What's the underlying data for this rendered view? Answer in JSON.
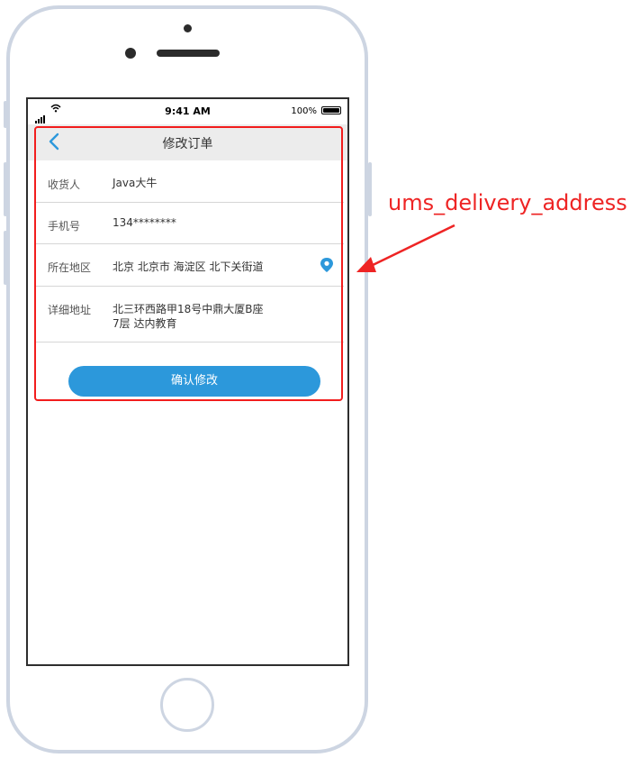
{
  "status_bar": {
    "time": "9:41 AM",
    "battery": "100%"
  },
  "nav": {
    "title": "修改订单"
  },
  "form": {
    "rows": [
      {
        "label": "收货人",
        "value": "Java大牛"
      },
      {
        "label": "手机号",
        "value": "134********"
      },
      {
        "label": "所在地区",
        "value": "北京 北京市 海淀区 北下关街道"
      },
      {
        "label": "详细地址",
        "value_line1": "北三环西路甲18号中鼎大厦B座",
        "value_line2": "7层 达内教育"
      }
    ],
    "confirm_label": "确认修改"
  },
  "annotation": {
    "text": "ums_delivery_address",
    "color": "#ee2424"
  },
  "colors": {
    "accent": "#2c98db",
    "highlight": "#f21d1d",
    "nav_bg": "#ececec"
  },
  "icons": {
    "back": "chevron-left-icon",
    "location": "location-pin-icon"
  }
}
